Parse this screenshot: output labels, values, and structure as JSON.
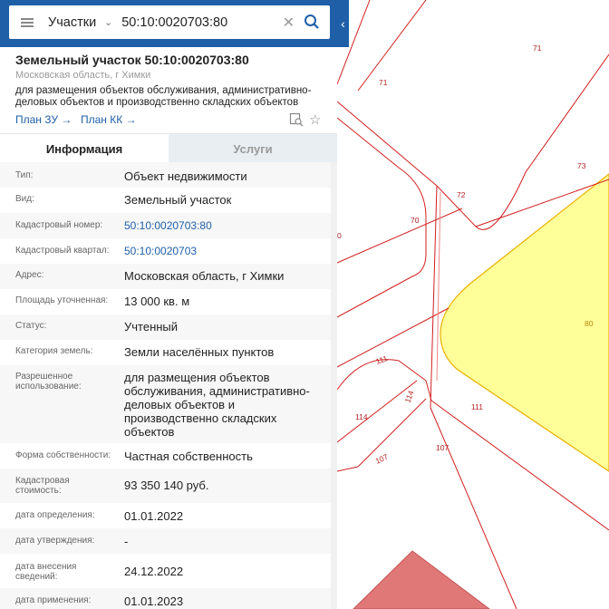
{
  "search": {
    "layer": "Участки",
    "query": "50:10:0020703:80"
  },
  "header": {
    "title": "Земельный участок 50:10:0020703:80",
    "subtitle": "Московская область, г Химки",
    "purpose": "для размещения объектов обслуживания, административно-деловых объектов и производственно складских объектов",
    "plan_zu": "План ЗУ →",
    "plan_kk": "План КК →"
  },
  "tabs": {
    "info": "Информация",
    "services": "Услуги"
  },
  "rows": [
    {
      "label": "Тип:",
      "value": "Объект недвижимости"
    },
    {
      "label": "Вид:",
      "value": "Земельный участок"
    },
    {
      "label": "Кадастровый номер:",
      "value": "50:10:0020703:80"
    },
    {
      "label": "Кадастровый квартал:",
      "value": "50:10:0020703"
    },
    {
      "label": "Адрес:",
      "value": "Московская область, г Химки"
    },
    {
      "label": "Площадь уточненная:",
      "value": "13 000 кв. м"
    },
    {
      "label": "Статус:",
      "value": "Учтенный"
    },
    {
      "label": "Категория земель:",
      "value": "Земли населённых пунктов"
    },
    {
      "label": "Разрешенное использование:",
      "value": "для размещения объектов обслуживания, административно-деловых объектов и производственно складских объектов"
    },
    {
      "label": "Форма собственности:",
      "value": "Частная собственность"
    },
    {
      "label": "Кадастровая стоимость:",
      "value": "93 350 140 руб."
    },
    {
      "label": "дата определения:",
      "value": "01.01.2022"
    },
    {
      "label": "дата утверждения:",
      "value": "-"
    },
    {
      "label": "дата внесения сведений:",
      "value": "24.12.2022"
    },
    {
      "label": "дата применения:",
      "value": "01.01.2023"
    }
  ],
  "map": {
    "labels": [
      "71",
      "71",
      "73",
      "72",
      "70",
      "0",
      "80",
      "111",
      "111",
      "114",
      "114",
      "107",
      "107"
    ],
    "colors": {
      "boundary": "#d21f1f",
      "selected_fill": "#ffff99",
      "selected_stroke": "#e8b000",
      "zone_fill": "#e07878"
    }
  },
  "colors": {
    "accent": "#1e5fa8"
  }
}
